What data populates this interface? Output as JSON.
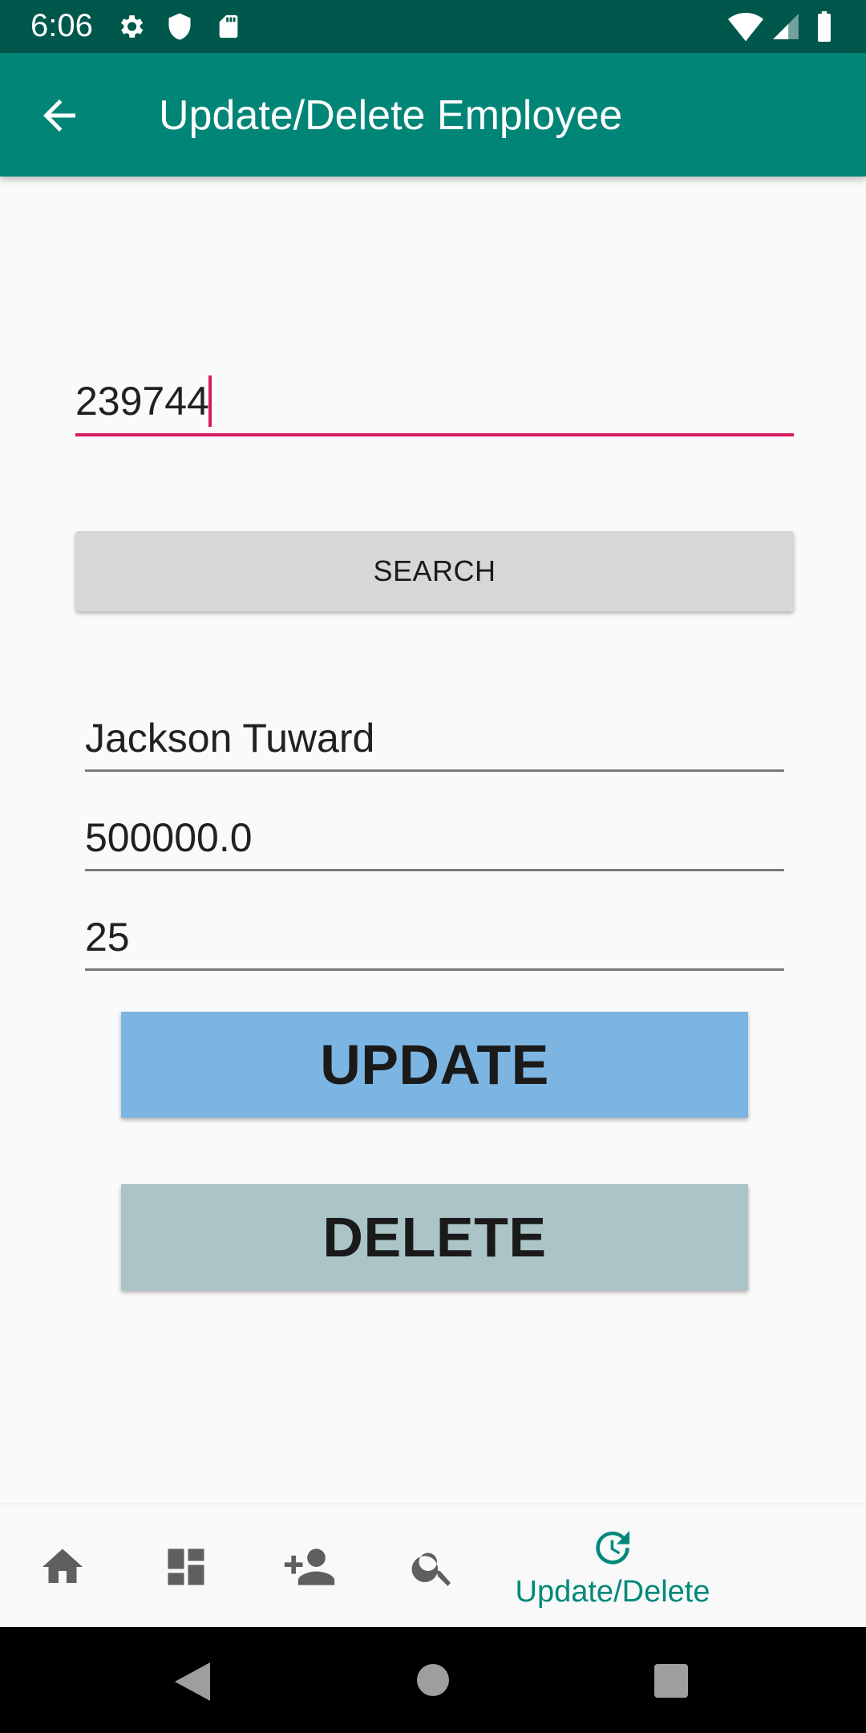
{
  "status_bar": {
    "time": "6:06",
    "icons": [
      "settings-icon",
      "shield-icon",
      "sd-card-icon",
      "wifi-icon",
      "signal-icon",
      "battery-icon"
    ]
  },
  "app_bar": {
    "title": "Update/Delete Employee",
    "back_icon": "arrow-back-icon",
    "background": "#008577"
  },
  "form": {
    "employee_id": "239744",
    "search_label": "SEARCH",
    "name": "Jackson Tuward",
    "salary": "500000.0",
    "age": "25",
    "update_label": "UPDATE",
    "delete_label": "DELETE"
  },
  "bottom_nav": {
    "items": [
      {
        "icon": "home-icon",
        "active": false
      },
      {
        "icon": "dashboard-icon",
        "active": false
      },
      {
        "icon": "person-add-icon",
        "active": false
      },
      {
        "icon": "search-icon",
        "active": false
      },
      {
        "icon": "update-icon",
        "label": "Update/Delete",
        "active": true
      }
    ],
    "active_color": "#00897b",
    "inactive_color": "#5f5f5f"
  },
  "system_nav": {
    "buttons": [
      "back-triangle-icon",
      "home-circle-icon",
      "recents-square-icon"
    ]
  },
  "colors": {
    "accent": "#d81b60",
    "status_bar": "#00574b",
    "update_button": "#7cb5e2",
    "delete_button": "#abc4c8"
  }
}
